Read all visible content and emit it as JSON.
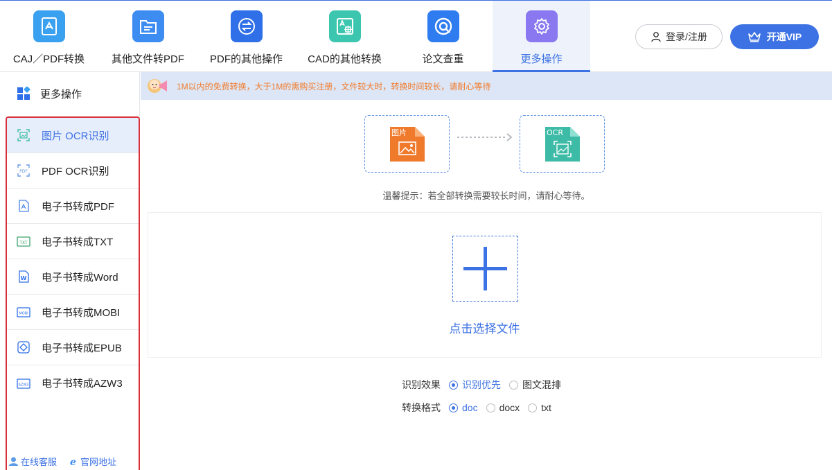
{
  "toolbar": {
    "tools": [
      {
        "label": "CAJ／PDF转换",
        "icon": "caj-pdf-convert-icon",
        "color": "#3aa0f0"
      },
      {
        "label": "其他文件转PDF",
        "icon": "file-to-pdf-icon",
        "color": "#3d8cf2"
      },
      {
        "label": "PDF的其他操作",
        "icon": "pdf-operations-icon",
        "color": "#2f6fe8"
      },
      {
        "label": "CAD的其他转换",
        "icon": "cad-convert-icon",
        "color": "#3cc6b0"
      },
      {
        "label": "论文查重",
        "icon": "paper-check-icon",
        "color": "#2f7cf0"
      },
      {
        "label": "更多操作",
        "icon": "gear-icon",
        "color": "#8a78f0"
      }
    ],
    "login_label": "登录/注册",
    "vip_label": "开通VIP"
  },
  "sidebar": {
    "header": "更多操作",
    "items": [
      {
        "label": "图片 OCR识别",
        "icon": "image-ocr-icon"
      },
      {
        "label": "PDF OCR识别",
        "icon": "pdf-ocr-icon"
      },
      {
        "label": "电子书转成PDF",
        "icon": "ebook-pdf-icon"
      },
      {
        "label": "电子书转成TXT",
        "icon": "ebook-txt-icon"
      },
      {
        "label": "电子书转成Word",
        "icon": "ebook-word-icon"
      },
      {
        "label": "电子书转成MOBI",
        "icon": "ebook-mobi-icon"
      },
      {
        "label": "电子书转成EPUB",
        "icon": "ebook-epub-icon"
      },
      {
        "label": "电子书转成AZW3",
        "icon": "ebook-azw3-icon"
      }
    ],
    "footer": {
      "service": "在线客服",
      "website": "官网地址"
    }
  },
  "notice": "1M以内的免费转换，大于1M的需购买注册，文件较大时，转换时间较长，请耐心等待",
  "conversion": {
    "source_label": "图片",
    "target_label": "OCR"
  },
  "hint": "温馨提示：若全部转换需要较长时间，请耐心等待。",
  "upload": {
    "label": "点击选择文件"
  },
  "options": {
    "effect": {
      "label": "识别效果",
      "choices": [
        "识别优先",
        "图文混排"
      ]
    },
    "format": {
      "label": "转换格式",
      "choices": [
        "doc",
        "docx",
        "txt"
      ]
    }
  },
  "colors": {
    "accent": "#3d72e4",
    "highlight_border": "#d9313c",
    "notice_text": "#f27a2a",
    "image_file": "#f07a2b",
    "ocr_file": "#3dbba6"
  }
}
